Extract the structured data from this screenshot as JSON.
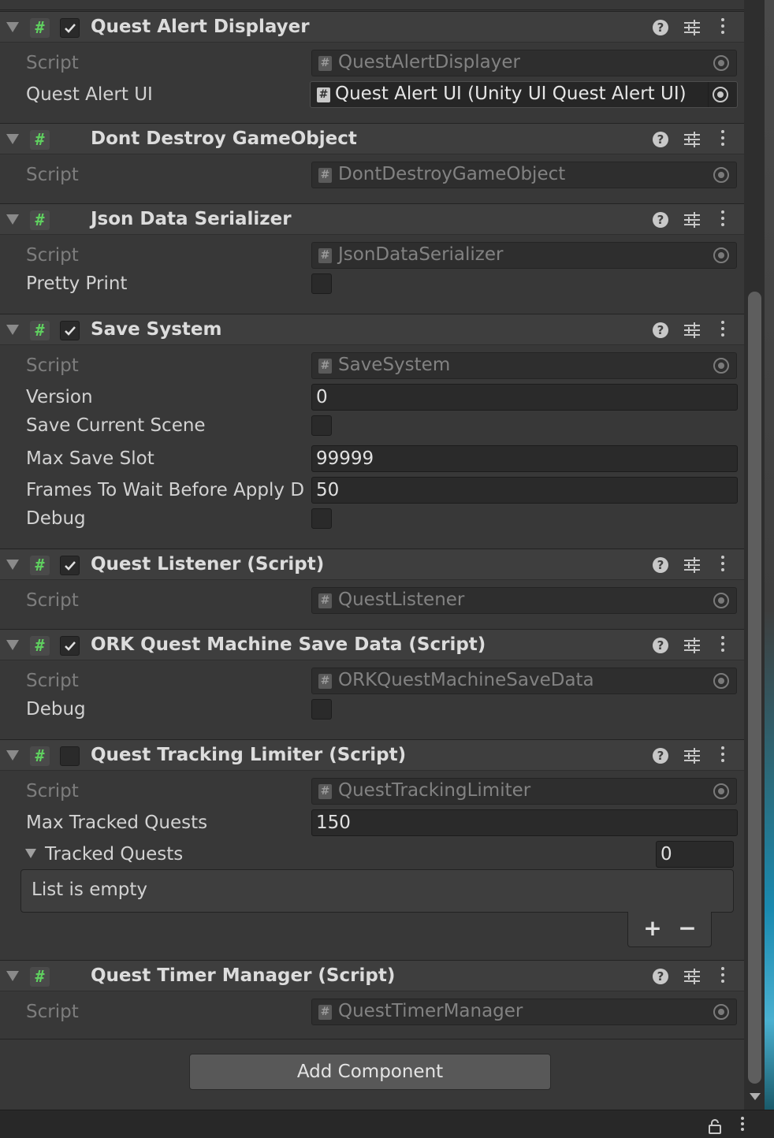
{
  "components": [
    {
      "title": "Quest Alert Displayer",
      "checkbox": true,
      "enabled": true,
      "props": [
        {
          "label": "Script",
          "value": "QuestAlertDisplayer"
        },
        {
          "label": "Quest Alert UI",
          "value": "Quest Alert UI (Unity UI Quest Alert UI)"
        }
      ]
    },
    {
      "title": "Dont Destroy GameObject",
      "checkbox": false,
      "props": [
        {
          "label": "Script",
          "value": "DontDestroyGameObject"
        }
      ]
    },
    {
      "title": "Json Data Serializer",
      "checkbox": false,
      "props": [
        {
          "label": "Script",
          "value": "JsonDataSerializer"
        },
        {
          "label": "Pretty Print",
          "checked": false
        }
      ]
    },
    {
      "title": "Save System",
      "checkbox": true,
      "enabled": true,
      "props": [
        {
          "label": "Script",
          "value": "SaveSystem"
        },
        {
          "label": "Version",
          "value": "0"
        },
        {
          "label": "Save Current Scene",
          "checked": false
        },
        {
          "label": "Max Save Slot",
          "value": "99999"
        },
        {
          "label": "Frames To Wait Before Apply D",
          "value": "50"
        },
        {
          "label": "Debug",
          "checked": false
        }
      ]
    },
    {
      "title": "Quest Listener (Script)",
      "checkbox": true,
      "enabled": true,
      "props": [
        {
          "label": "Script",
          "value": "QuestListener"
        }
      ]
    },
    {
      "title": "ORK Quest Machine Save Data (Script)",
      "checkbox": true,
      "enabled": true,
      "props": [
        {
          "label": "Script",
          "value": "ORKQuestMachineSaveData"
        },
        {
          "label": "Debug",
          "checked": false
        }
      ]
    },
    {
      "title": "Quest Tracking Limiter (Script)",
      "checkbox": true,
      "enabled": false,
      "props": [
        {
          "label": "Script",
          "value": "QuestTrackingLimiter"
        },
        {
          "label": "Max Tracked Quests",
          "value": "150"
        },
        {
          "label": "Tracked Quests",
          "size": "0",
          "empty_text": "List is empty"
        }
      ]
    },
    {
      "title": "Quest Timer Manager (Script)",
      "checkbox": false,
      "props": [
        {
          "label": "Script",
          "value": "QuestTimerManager"
        }
      ]
    }
  ],
  "glyphs": {
    "hash": "#",
    "help": "?",
    "plus": "+",
    "minus": "−"
  },
  "add_component_label": "Add Component",
  "colors": {
    "panel": "#383838",
    "header": "#3e3e3e",
    "script_hash_green": "#5fcf5f",
    "button": "#585858"
  }
}
